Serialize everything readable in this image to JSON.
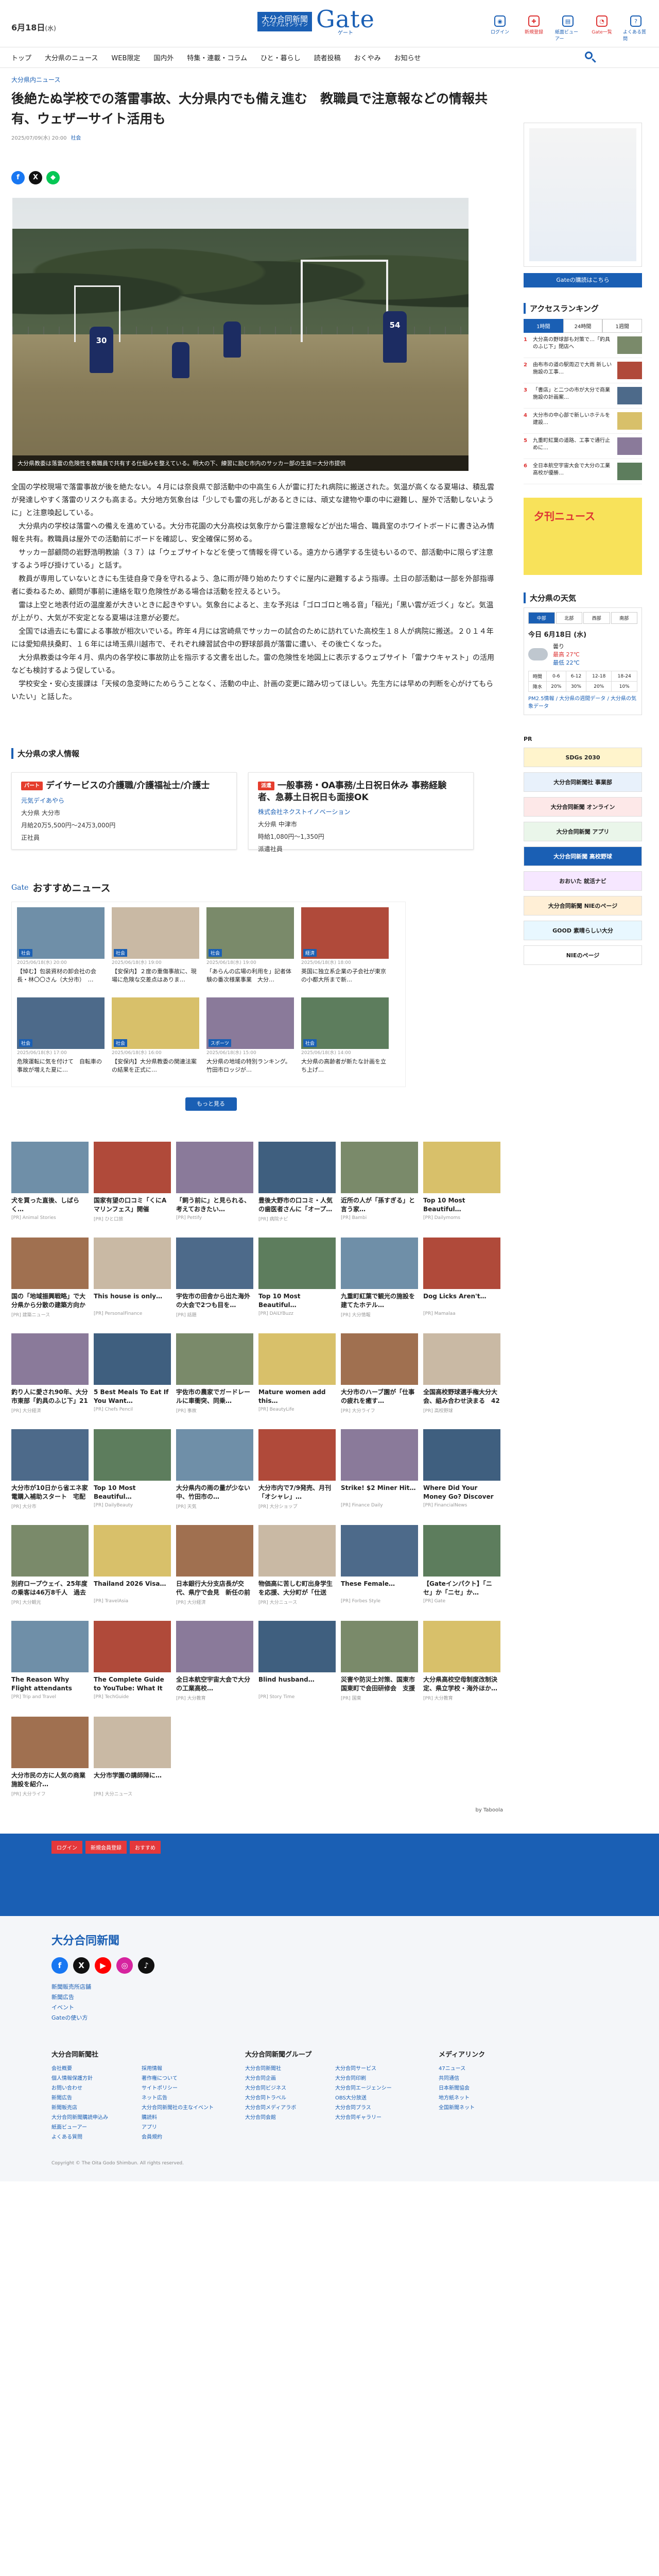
{
  "header": {
    "date_prefix": "6月18日",
    "date_dow": "(水)",
    "logo_paper": "大分合同新聞",
    "logo_paper_sub": "プレミアムオンライン",
    "logo_gate": "Gate",
    "logo_gate_kana": "ゲート",
    "icons": [
      {
        "icon": "user-icon",
        "label": "ログイン"
      },
      {
        "icon": "register-icon",
        "label": "新規登録"
      },
      {
        "icon": "paper-icon",
        "label": "紙面ビューアー"
      },
      {
        "icon": "rss-icon",
        "label": "Gate一覧"
      },
      {
        "icon": "help-icon",
        "label": "よくある質問"
      }
    ]
  },
  "nav": [
    "トップ",
    "大分県のニュース",
    "WEB限定",
    "国内外",
    "特集・連載・コラム",
    "ひと・暮らし",
    "読者投稿",
    "おくやみ",
    "お知らせ"
  ],
  "article": {
    "crumb": "大分県内ニュース",
    "title": "後絶たぬ学校での落雷事故、大分県内でも備え進む　教職員で注意報などの情報共有、ウェザーサイト活用も",
    "date": "2025/07/09(水) 20:00",
    "category": "社会",
    "caption": "大分県教委は落雷の危険性を教職員で共有する仕組みを整えている。明大の下、練習に励む市内のサッカー部の生徒＝大分市提供",
    "jersey_1": "30",
    "jersey_2": "54",
    "paragraphs": [
      "全国の学校現場で落雷事故が後を絶たない。４月には奈良県で部活動中の中高生６人が雷に打たれ病院に搬送された。気温が高くなる夏場は、積乱雲が発達しやすく落雷のリスクも高まる。大分地方気象台は「少しでも雷の兆しがあるときには、頑丈な建物や車の中に避難し、屋外で活動しないように」と注意喚起している。",
      "　大分県内の学校は落雷への備えを進めている。大分市花園の大分高校は気象庁から雷注意報などが出た場合、職員室のホワイトボードに書き込み情報を共有。教職員は屋外での活動前にボードを確認し、安全確保に努める。",
      "　サッカー部顧問の岩野浩明教諭（３７）は「ウェブサイトなどを使って情報を得ている。遠方から通学する生徒もいるので、部活動中に限らず注意するよう呼び掛けている」と話す。",
      "　教員が専用していないときにも生徒自身で身を守れるよう、急に雨が降り始めたりすぐに屋内に避難するよう指導。土日の部活動は一部を外部指導者に委ねるため、顧問が事前に連絡を取り危険性がある場合は活動を控えるという。",
      "　雷は上空と地表付近の温度差が大きいときに起きやすい。気象台によると、主な予兆は「ゴロゴロと鳴る音」「稲光」「黒い雲が近づく」など。気温が上がり、大気が不安定となる夏場は注意が必要だ。",
      "　全国では過去にも雷による事故が相次いでいる。昨年４月には宮崎県でサッカーの試合のために訪れていた高校生１８人が病院に搬送。２０１４年には愛知県扶桑町、１６年には埼玉県川越市で、それぞれ練習試合中の野球部員が落雷に遭い、その後亡くなった。",
      "　大分県教委は今年４月、県内の各学校に事故防止を指示する文書を出した。雷の危険性を地図上に表示するウェブサイト「雷ナウキャスト」の活用なども検討するよう促している。",
      "　学校安全・安心支援課は「天候の急変時にためらうことなく、活動の中止、計画の変更に踏み切ってほしい。先生方には早めの判断を心がけてもらいたい」と話した。"
    ]
  },
  "jobs": {
    "heading": "大分県の求人情報",
    "items": [
      {
        "tag": "パート",
        "title": "デイサービスの介護職/介護福祉士/介護士",
        "company": "元気デイあやら",
        "place": "大分県 大分市",
        "pay": "月給20万5,500円～24万3,000円",
        "type": "正社員"
      },
      {
        "tag": "派遣",
        "title": "一般事務・OA事務/土日祝日休み 事務経験者、急募土日祝日も面接OK",
        "company": "株式会社ネクストイノベーション",
        "place": "大分県 中津市",
        "pay": "時給1,080円～1,350円",
        "type": "派遣社員"
      }
    ]
  },
  "reco": {
    "gate_label": "Gate",
    "heading": "おすすめニュース",
    "more": "もっと見る",
    "items": [
      {
        "label": "社会",
        "title": "【悼む】包装資材の卸会社の会長・林〇〇さん（大分市）　…",
        "date": "2025/06/18(水) 20:00"
      },
      {
        "label": "社会",
        "title": "【安保内】２度の重傷事故に、現場に危険な交差点はありま…",
        "date": "2025/06/18(水) 19:00"
      },
      {
        "label": "社会",
        "title": "「あらんの広場の利用を」記者体験の番次様業事業　大分…",
        "date": "2025/06/18(水) 19:00"
      },
      {
        "label": "経済",
        "title": "英国に独立系企業の子会社が東京の小都大所まで新…",
        "date": "2025/06/18(水) 18:00"
      },
      {
        "label": "社会",
        "title": "危険運転に気を付けて　自転車の事故が増えた夏に…",
        "date": "2025/06/18(水) 17:00"
      },
      {
        "label": "社会",
        "title": "【安保内】大分県教委の関連法案の結果を正式に…",
        "date": "2025/06/18(水) 16:00"
      },
      {
        "label": "スポーツ",
        "title": "大分県の地域の特別ランキング。竹田市ロッジが…",
        "date": "2025/06/18(水) 15:00"
      },
      {
        "label": "社会",
        "title": "大分県の高齢者が新たな計画を立ち上げ…",
        "date": "2025/06/18(水) 14:00"
      }
    ]
  },
  "ads": [
    {
      "title": "犬を買った直後、しばらく…",
      "source": "[PR] Animal Stories"
    },
    {
      "title": "国家有望の口コミ「くにAマリンフェス」開催",
      "source": "[PR] ひと口旅"
    },
    {
      "title": "「飼う前に」と見られる、考えておきたい…",
      "source": "[PR] Pettify"
    },
    {
      "title": "豊後大野市の口コミ・人気の歯医者さんに「オープ…",
      "source": "[PR] 病院ナビ"
    },
    {
      "title": "近所の人が「孫すぎる」と言う家…",
      "source": "[PR] Bambi"
    },
    {
      "title": "Top 10 Most Beautiful…",
      "source": "[PR] Dailymoms"
    },
    {
      "title": "国の「地域振興戦略」で大分県から分散の建築方向から…",
      "source": "[PR] 建築ニュース"
    },
    {
      "title": "This house is only…",
      "source": "[PR] PersonalFinance"
    },
    {
      "title": "宇佐市の田舎から出た海外の大会で2つも目を…",
      "source": "[PR] 話題"
    },
    {
      "title": "Top 10 Most Beautiful…",
      "source": "[PR] DAILYBuzz"
    },
    {
      "title": "九重町紅葉で観光の施設を建てたホテル…",
      "source": "[PR] 大分情報"
    },
    {
      "title": "Dog Licks Aren't…",
      "source": "[PR] Mamalaa"
    },
    {
      "title": "釣り人に愛され90年、大分市東部「釣具のふじ下」21日で閉店",
      "source": "[PR] 大分経済"
    },
    {
      "title": "5 Best Meals To Eat If You Want…",
      "source": "[PR] Chefs Pencil"
    },
    {
      "title": "宇佐市の農家でガードレールに車衝突、同乗…",
      "source": "[PR] 事故"
    },
    {
      "title": "Mature women add this…",
      "source": "[PR] BeautyLife"
    },
    {
      "title": "大分市のハーブ園が「仕事の疲れを癒す…",
      "source": "[PR] 大分ライフ"
    },
    {
      "title": "全国高校野球選手権大分大会、組み合わせ決まる　42校41チーム…",
      "source": "[PR] 高校野球"
    },
    {
      "title": "大分市が10日から省エネ家電購入補助スタート　宅配ボックス…",
      "source": "[PR] 大分市"
    },
    {
      "title": "Top 10 Most Beautiful…",
      "source": "[PR] DailyBeauty"
    },
    {
      "title": "大分県内の雨の量が少ない中、竹田市の…",
      "source": "[PR] 天気"
    },
    {
      "title": "大分市内で7/9発売、月刊「オシャレ」…",
      "source": "[PR] 大分ショップ"
    },
    {
      "title": "Strike! $2 Miner Hit…",
      "source": "[PR] Finance Daily"
    },
    {
      "title": "Where Did Your Money Go? Discover the history…",
      "source": "[PR] FinancialNews"
    },
    {
      "title": "別府ロープウェイ、25年度の乗客は46万8千人　過去最多更新…",
      "source": "[PR] 大分観光"
    },
    {
      "title": "Thailand 2026 Visa…",
      "source": "[PR] TravelAsia"
    },
    {
      "title": "日本銀行大分支店長が交代、県庁で会見　新任の前田氏「地元…",
      "source": "[PR] 大分経済"
    },
    {
      "title": "物価高に苦しむ町出身学生を応援、大分町が「仕送り」…",
      "source": "[PR] 大分ニュース"
    },
    {
      "title": "These Female…",
      "source": "[PR] Forbes Style"
    },
    {
      "title": "【Gateインパクト】「ニセ」か「ニセ」か…",
      "source": "[PR] Gate"
    },
    {
      "title": "The Reason Why Flight attendants can't…",
      "source": "[PR] Trip and Travel"
    },
    {
      "title": "The Complete Guide to YouTube: What It Is…",
      "source": "[PR] TechGuide"
    },
    {
      "title": "全日本航空宇宙大会で大分の工業高校…",
      "source": "[PR] 大分教育"
    },
    {
      "title": "Blind husband…",
      "source": "[PR] Story Time"
    },
    {
      "title": "災害や防災土対策、国東市国東町で会田研修会　支援に備え…",
      "source": "[PR] 国東"
    },
    {
      "title": "大分県高校空母制度改制決定、県立学校・海外ほか…",
      "source": "[PR] 大分教育"
    },
    {
      "title": "大分市民の方に人気の商業施設を紹介…",
      "source": "[PR] 大分ライフ"
    },
    {
      "title": "大分市学園の講師陣に…",
      "source": "[PR] 大分ニュース"
    }
  ],
  "taboola": "by Taboola",
  "sidebar": {
    "side_btn": "Gateの購読はこちら",
    "rank_heading": "アクセスランキング",
    "rank_tabs": [
      "1時間",
      "24時間",
      "1週間"
    ],
    "rank_items": [
      "大分高の野球部も対策で…「釣具のふじ下」閉店へ",
      "由布市の道の駅周辺で大雨 新しい施設の工事…",
      "「書店」と二つの市が大分で商業施設の計画案…",
      "大分市の中心部で新しいホテルを建設…",
      "九重町紅葉の道路、工事で通行止めに…",
      "全日本航空宇宙大会で大分の工業高校が優勝…"
    ],
    "promo": "夕刊ニュース",
    "wx_heading": "大分県の天気",
    "wx_tabs": [
      "中部",
      "北部",
      "西部",
      "南部"
    ],
    "wx_day": "今日 6月18日 (水)",
    "wx_cond": "曇り",
    "wx_hi": "最高 27℃",
    "wx_lo": "最低 22℃",
    "wx_times": [
      "時間",
      "0-6",
      "6-12",
      "12-18",
      "18-24"
    ],
    "wx_rain": [
      "降水",
      "20%",
      "30%",
      "20%",
      "10%"
    ],
    "wx_foot": "PM2.5情報 / 大分県の週間データ / 大分県の気象データ",
    "pr": "PR",
    "banners": [
      "SDGs 2030",
      "大分合同新聞社 事業部",
      "大分合同新聞 オンライン",
      "大分合同新聞 アプリ",
      "大分合同新聞 高校野球",
      "おおいた 就活ナビ",
      "大分合同新聞 NIEのページ",
      "GOOD 素晴らしい大分",
      "NIEのページ"
    ]
  },
  "footer": {
    "buttons": [
      "ログイン",
      "新規会員登録",
      "おすすめ"
    ],
    "logo": "大分合同新聞",
    "links": [
      "新聞販売所店舗",
      "新聞広告",
      "イベント",
      "Gateの使い方"
    ],
    "col1_h": "大分合同新聞社",
    "col1": [
      "会社概要",
      "採用情報",
      "個人情報保護方針",
      "著作権について",
      "お問い合わせ",
      "サイトポリシー",
      "新聞広告",
      "ネット広告",
      "新聞販売店",
      "大分合同新聞社の主なイベント",
      "大分合同新聞購読申込み",
      "購読料",
      "紙面ビューアー",
      "アプリ",
      "よくある質問",
      "会員規約"
    ],
    "col2_h": "大分合同新聞グループ",
    "col2": [
      "大分合同新聞社",
      "大分合同サービス",
      "大分合同企画",
      "大分合同印刷",
      "大分合同ビジネス",
      "大分合同エージェンシー",
      "大分合同トラベル",
      "OBS大分放送",
      "大分合同メディアラボ",
      "大分合同プラス",
      "大分合同会館",
      "大分合同ギャラリー"
    ],
    "col3_h": "メディアリンク",
    "col3": [
      "47ニュース",
      "共同通信",
      "日本新聞協会",
      "地方紙ネット",
      "全国新聞ネット"
    ],
    "copyright": "Copyright © The Oita Godo Shimbun. All rights reserved."
  }
}
